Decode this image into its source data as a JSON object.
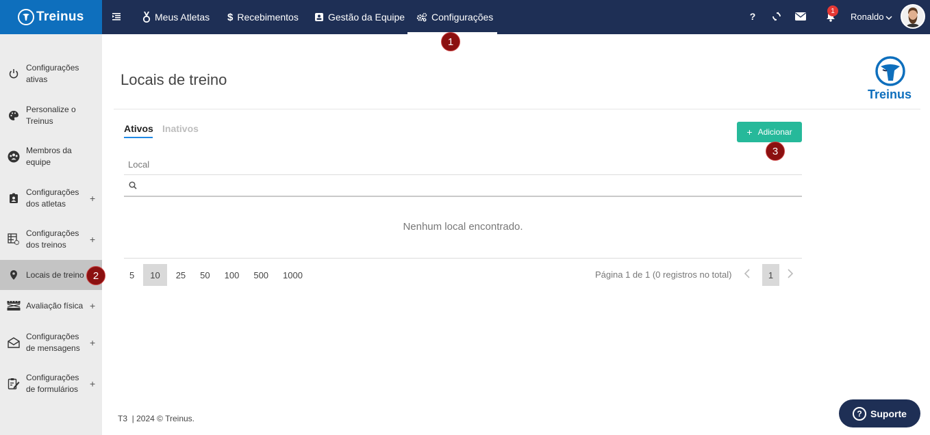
{
  "brand": {
    "name": "Treinus"
  },
  "topnav": {
    "items": [
      {
        "label": "Meus Atletas",
        "icon": "medal-icon"
      },
      {
        "label": "Recebimentos",
        "icon": "dollar-icon"
      },
      {
        "label": "Gestão da Equipe",
        "icon": "id-card-icon"
      },
      {
        "label": "Configurações",
        "icon": "gears-icon",
        "active": true
      }
    ],
    "help_label": "?",
    "notification_count": "1",
    "user_name": "Ronaldo"
  },
  "sidebar": {
    "items": [
      {
        "label": "Configurações ativas",
        "icon": "power-icon",
        "expandable": false
      },
      {
        "label": "Personalize o Treinus",
        "icon": "palette-icon",
        "expandable": false
      },
      {
        "label": "Membros da equipe",
        "icon": "team-icon",
        "expandable": false
      },
      {
        "label": "Configurações dos atletas",
        "icon": "athlete-badge-icon",
        "expandable": true
      },
      {
        "label": "Configurações dos treinos",
        "icon": "workout-grid-icon",
        "expandable": true
      },
      {
        "label": "Locais de treino",
        "icon": "map-pin-icon",
        "expandable": false,
        "active": true
      },
      {
        "label": "Avaliação física",
        "icon": "ruler-icon",
        "expandable": true
      },
      {
        "label": "Configurações de mensagens",
        "icon": "envelope-open-icon",
        "expandable": true
      },
      {
        "label": "Configurações de formulários",
        "icon": "form-edit-icon",
        "expandable": true
      }
    ],
    "plus_symbol": "+"
  },
  "main": {
    "title": "Locais de treino",
    "tabs": [
      {
        "label": "Ativos",
        "active": true
      },
      {
        "label": "Inativos",
        "active": false
      }
    ],
    "add_button": {
      "icon_text": "+",
      "label": "Adicionar"
    },
    "table": {
      "column_header": "Local",
      "filter_value": "",
      "empty_message": "Nenhum local encontrado."
    },
    "pagination": {
      "page_sizes": [
        "5",
        "10",
        "25",
        "50",
        "100",
        "500",
        "1000"
      ],
      "selected_size": "10",
      "info": "Página 1 de 1 (0 registros no total)",
      "current_page": "1"
    }
  },
  "footer": {
    "text": "T3  | 2024 © Treinus."
  },
  "support": {
    "label": "Suporte",
    "icon_text": "?"
  },
  "steps": [
    "1",
    "2",
    "3"
  ],
  "colors": {
    "topbar": "#1e2f55",
    "brand": "#0e6fbd",
    "accent_green": "#26b99a",
    "tab_underline": "#1e88e5",
    "step_marker": "#8b1010"
  }
}
